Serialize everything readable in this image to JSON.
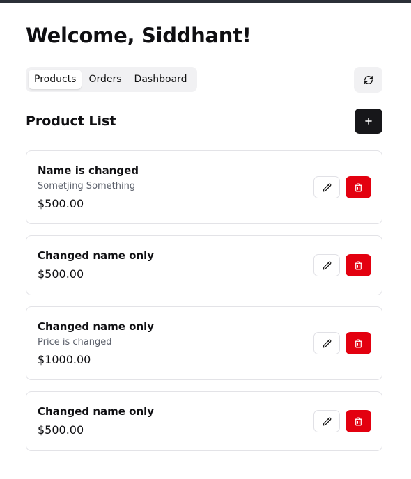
{
  "header": {
    "title": "Welcome, Siddhant!"
  },
  "tabs": [
    {
      "label": "Products",
      "active": true
    },
    {
      "label": "Orders",
      "active": false
    },
    {
      "label": "Dashboard",
      "active": false
    }
  ],
  "toolbar": {
    "refresh_icon": "refresh-icon",
    "add_icon": "plus-icon"
  },
  "section": {
    "title": "Product List"
  },
  "products": [
    {
      "name": "Name is changed",
      "description": "Sometjing Something",
      "price": "$500.00"
    },
    {
      "name": "Changed name only",
      "description": "",
      "price": "$500.00"
    },
    {
      "name": "Changed name only",
      "description": "Price is changed",
      "price": "$1000.00"
    },
    {
      "name": "Changed name only",
      "description": "",
      "price": "$500.00"
    }
  ],
  "actions": {
    "edit_icon": "pencil-icon",
    "delete_icon": "trash-icon"
  },
  "colors": {
    "primary": "#17171a",
    "danger": "#e3000f",
    "muted": "#f1f1f3",
    "border": "#e3e3e7"
  }
}
